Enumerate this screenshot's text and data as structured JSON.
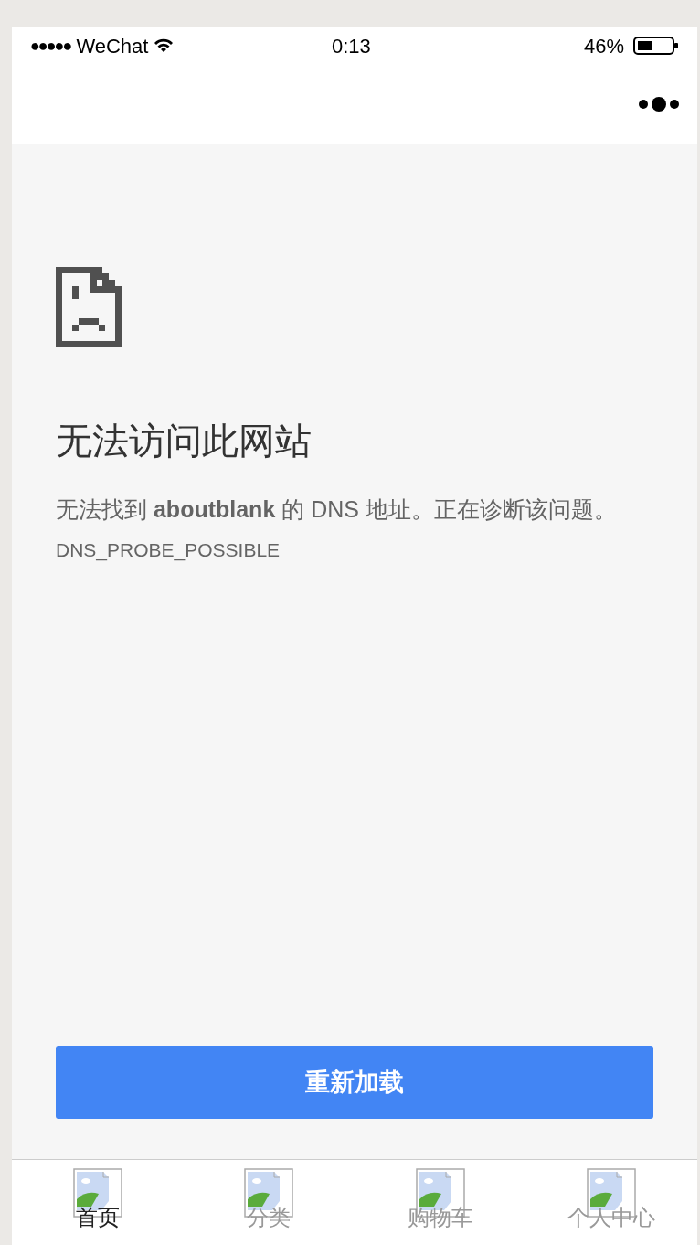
{
  "status_bar": {
    "signal": "●●●●●",
    "carrier": "WeChat",
    "time": "0:13",
    "battery": "46%"
  },
  "error_page": {
    "title": "无法访问此网站",
    "message": "无法找到 **aboutblank** 的 DNS 地址。正在诊断该问题。",
    "code": "DNS_PROBE_POSSIBLE",
    "reload_button": "重新加载"
  },
  "tab_bar": [
    {
      "label": "首页",
      "selected": true
    },
    {
      "label": "分类",
      "selected": false
    },
    {
      "label": "购物车",
      "selected": false
    },
    {
      "label": "个人中心",
      "selected": false
    }
  ]
}
